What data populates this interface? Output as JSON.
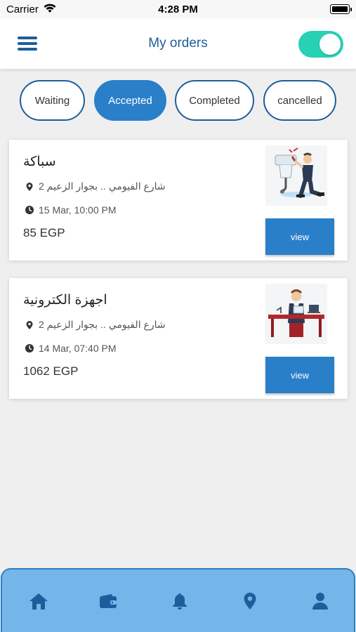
{
  "status_bar": {
    "carrier": "Carrier",
    "time": "4:28 PM"
  },
  "header": {
    "title": "My orders",
    "toggle_on": true,
    "toggle_color": "#27d1b4"
  },
  "tabs": [
    {
      "label": "Waiting",
      "active": false
    },
    {
      "label": "Accepted",
      "active": true
    },
    {
      "label": "Completed",
      "active": false
    },
    {
      "label": "cancelled",
      "active": false
    }
  ],
  "orders": [
    {
      "title": "سباكة",
      "address": "شارع الفيومي .. بجوار الزعيم 2",
      "date": "15 Mar, 10:00 PM",
      "price": "85 EGP",
      "image_icon": "plumber-illustration",
      "button_label": "view"
    },
    {
      "title": "اجهزة الكترونية",
      "address": "شارع الفيومي .. بجوار الزعيم 2",
      "date": "14 Mar, 07:40 PM",
      "price": "1062 EGP",
      "image_icon": "technician-desk-illustration",
      "button_label": "view"
    }
  ],
  "bottom_nav": {
    "items": [
      "home-icon",
      "wallet-icon",
      "bell-icon",
      "location-pin-icon",
      "user-icon"
    ],
    "active": "bell-icon"
  },
  "colors": {
    "primary": "#1d5d9b",
    "accent": "#2a7fc9",
    "nav_background": "#74b6ea"
  }
}
